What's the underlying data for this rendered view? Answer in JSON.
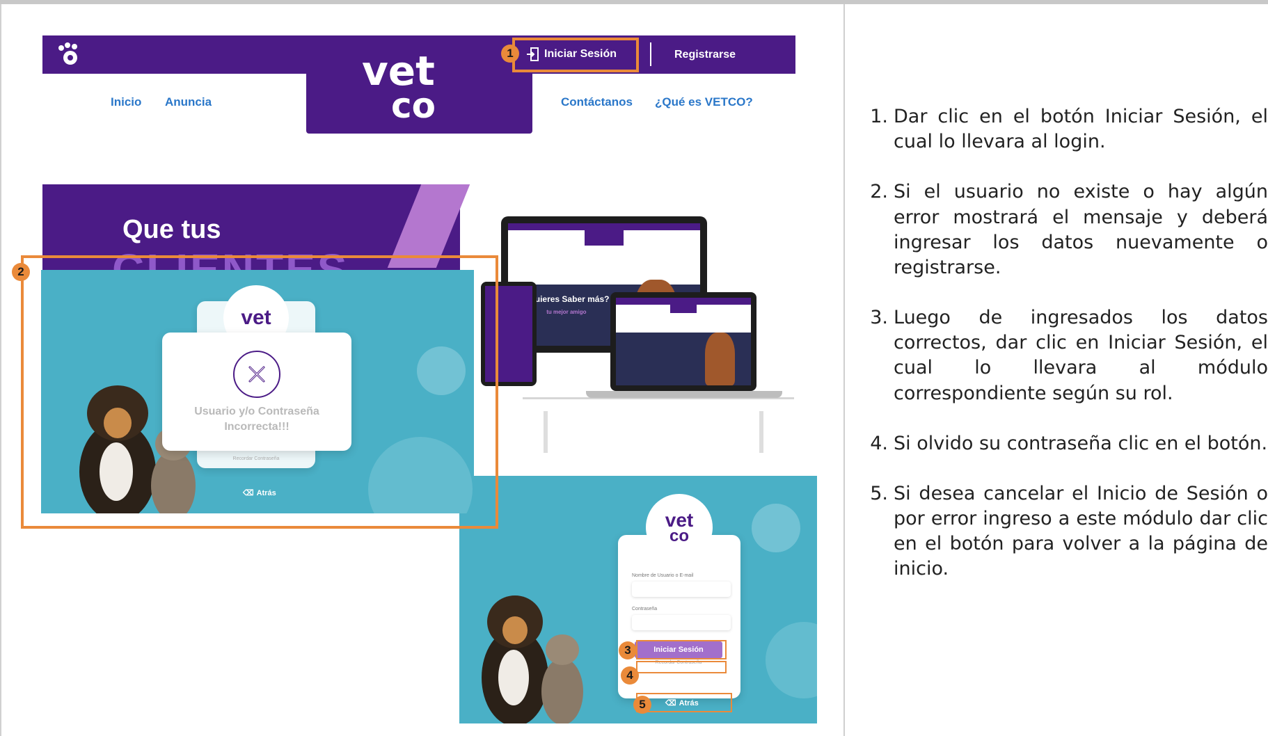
{
  "website": {
    "brand": "VETCO",
    "logo_top": "vet",
    "logo_bottom": "co",
    "login_label": "Iniciar Sesión",
    "register_label": "Registrarse",
    "nav": [
      "Inicio",
      "Anuncia",
      "Contáctanos",
      "¿Qué es VETCO?"
    ],
    "hero_title": "Que tus",
    "hero_highlight": "CLIENTES",
    "device_banner": "¿Quieres Saber más?",
    "device_sub": "tu mejor amigo"
  },
  "error_screen": {
    "logo": "vet",
    "message_line1": "Usuario y/o Contraseña",
    "message_line2": "Incorrecta!!!",
    "forgot_label": "Recordar Contraseña",
    "back_label": "Atrás"
  },
  "login_screen": {
    "logo_top": "vet",
    "logo_bottom": "co",
    "user_label": "Nombre de Usuario o E-mail",
    "password_label": "Contraseña",
    "login_button": "Iniciar Sesión",
    "forgot_label": "Recordar Contraseña",
    "back_label": "Atrás"
  },
  "callouts": [
    "1",
    "2",
    "3",
    "4",
    "5"
  ],
  "colors": {
    "brand_purple": "#4b1b86",
    "nav_blue": "#2a77c9",
    "teal_bg": "#4ab0c6",
    "button_purple": "#a26fcb",
    "highlight_orange": "#ea8a3a"
  },
  "steps": [
    {
      "num": "1.",
      "text": "Dar clic en el botón Iniciar Sesión, el cual lo llevara al login."
    },
    {
      "num": "2.",
      "text": "Si el usuario no existe o hay algún error mostrará el mensaje y deberá ingresar los datos nuevamente o registrarse."
    },
    {
      "num": "3.",
      "text": "Luego de ingresados los datos correctos, dar clic en Iniciar Sesión, el cual lo llevara al módulo correspondiente según su rol."
    },
    {
      "num": "4.",
      "text": "Si olvido su contraseña clic en el botón."
    },
    {
      "num": "5.",
      "text": "Si desea cancelar el Inicio de Sesión o por error ingreso a este módulo dar clic en el botón para volver a la página de inicio."
    }
  ]
}
